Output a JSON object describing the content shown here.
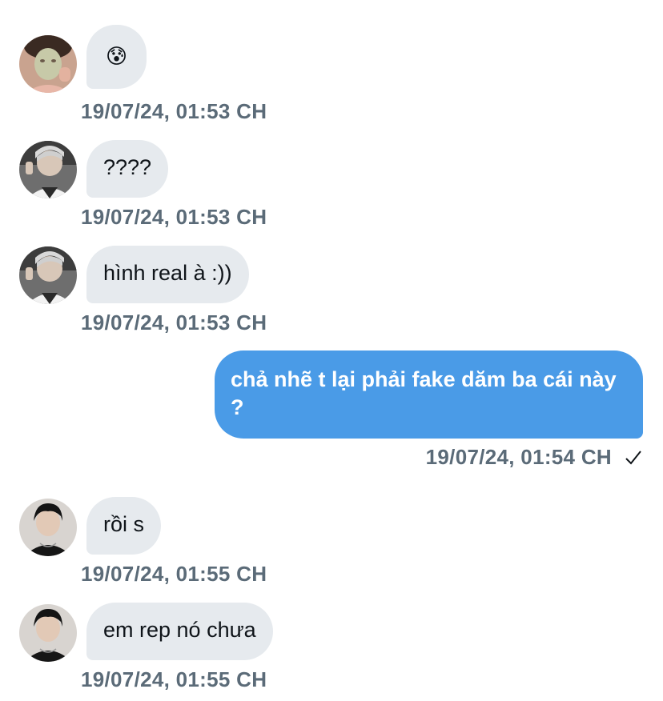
{
  "messages": [
    {
      "sender": "contact",
      "avatar": "face-mask-person",
      "text": "😰",
      "timestamp": "19/07/24, 01:53 CH"
    },
    {
      "sender": "contact",
      "avatar": "silver-hair-person",
      "text": "????",
      "timestamp": "19/07/24, 01:53 CH"
    },
    {
      "sender": "contact",
      "avatar": "silver-hair-person",
      "text": "hình real à :))",
      "timestamp": "19/07/24, 01:53 CH"
    },
    {
      "sender": "me",
      "text": "chả nhẽ t lại phải fake dăm ba cái này ?",
      "timestamp": "19/07/24, 01:54 CH",
      "status_icon": "checkmark-icon"
    },
    {
      "sender": "contact",
      "avatar": "dark-hair-person",
      "text": "rồi s",
      "timestamp": "19/07/24, 01:55 CH"
    },
    {
      "sender": "contact",
      "avatar": "dark-hair-person",
      "text": "em rep nó chưa",
      "timestamp": "19/07/24, 01:55 CH"
    }
  ],
  "colors": {
    "incoming_bubble": "#e6eaee",
    "outgoing_bubble": "#4a9be7",
    "timestamp": "#5b6b78"
  }
}
